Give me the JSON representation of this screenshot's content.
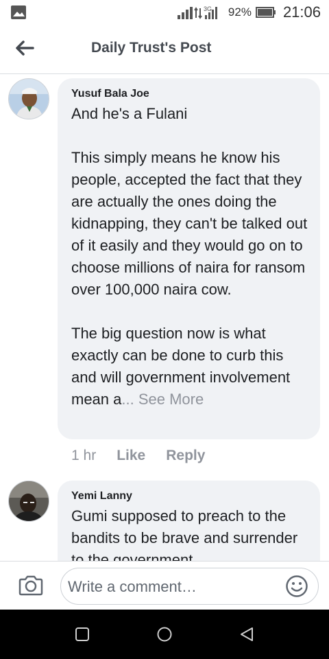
{
  "status_bar": {
    "network": "3G",
    "battery_percent": "92%",
    "time": "21:06"
  },
  "header": {
    "title": "Daily Trust's Post"
  },
  "comments": [
    {
      "author": "Yusuf Bala Joe",
      "text": "And he's a Fulani\n\nThis simply means he know his people, accepted the fact that they are actually the ones doing the kidnapping, they can't be talked out of it easily and they would go on to choose millions of naira for ransom over 100,000 naira cow.\n\nThe big question now is what exactly can be done to curb this and will government involvement mean a",
      "see_more": "... See More",
      "time": "1 hr",
      "like_label": "Like",
      "reply_label": "Reply"
    },
    {
      "author": "Yemi Lanny",
      "text": "Gumi supposed to preach to the bandits to be brave and surrender to the government"
    }
  ],
  "composer": {
    "placeholder": "Write a comment…"
  },
  "icons": {
    "gallery": "gallery-icon",
    "signal": "signal-icon",
    "battery": "battery-icon",
    "back": "back-arrow-icon",
    "camera": "camera-icon",
    "emoji": "emoji-icon",
    "nav_recent": "recent-apps-icon",
    "nav_home": "home-icon",
    "nav_back": "nav-back-icon"
  }
}
